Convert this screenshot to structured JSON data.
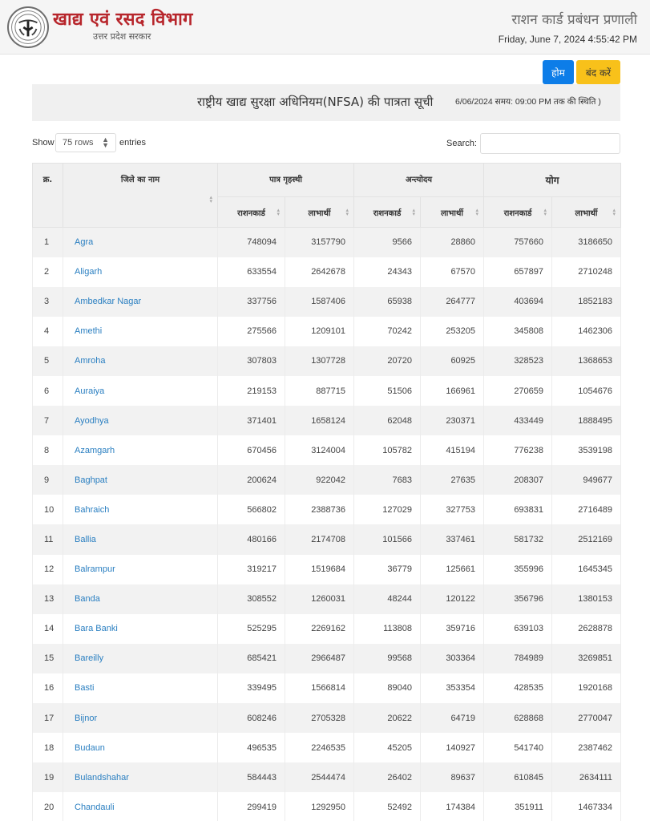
{
  "header": {
    "brand_title": "खाद्य एवं रसद विभाग",
    "brand_subtitle": "उत्तर प्रदेश सरकार",
    "system_title": "राशन कार्ड प्रबंधन प्रणाली",
    "datetime": "Friday, June 7, 2024 4:55:42 PM",
    "logo_icon": "up-govt-emblem-icon"
  },
  "actions": {
    "home_label": "होम",
    "close_label": "बंद करें",
    "home_color": "#0d7de8",
    "close_color": "#f8c11a"
  },
  "page": {
    "title": "राष्ट्रीय खाद्य सुरक्षा अधिनियम(NFSA) की पात्रता सूची",
    "status_note": "6/06/2024 समय: 09:00 PM तक की स्थिति )"
  },
  "controls": {
    "show_label": "Show",
    "rows_selected": "75 rows",
    "entries_label": "entries",
    "search_label": "Search:",
    "search_value": ""
  },
  "table": {
    "headers": {
      "serial": "क्र.",
      "district": "जिले का नाम",
      "groups": [
        "पात्र गृहस्थी",
        "अन्त्योदय",
        "योग"
      ],
      "sub": [
        "राशनकार्ड",
        "लाभार्थी",
        "राशनकार्ड",
        "लाभार्थी",
        "राशनकार्ड",
        "लाभार्थी"
      ]
    },
    "rows": [
      {
        "sn": "1",
        "district": "Agra",
        "v": [
          "748094",
          "3157790",
          "9566",
          "28860",
          "757660",
          "3186650"
        ]
      },
      {
        "sn": "2",
        "district": "Aligarh",
        "v": [
          "633554",
          "2642678",
          "24343",
          "67570",
          "657897",
          "2710248"
        ]
      },
      {
        "sn": "3",
        "district": "Ambedkar Nagar",
        "v": [
          "337756",
          "1587406",
          "65938",
          "264777",
          "403694",
          "1852183"
        ]
      },
      {
        "sn": "4",
        "district": "Amethi",
        "v": [
          "275566",
          "1209101",
          "70242",
          "253205",
          "345808",
          "1462306"
        ]
      },
      {
        "sn": "5",
        "district": "Amroha",
        "v": [
          "307803",
          "1307728",
          "20720",
          "60925",
          "328523",
          "1368653"
        ]
      },
      {
        "sn": "6",
        "district": "Auraiya",
        "v": [
          "219153",
          "887715",
          "51506",
          "166961",
          "270659",
          "1054676"
        ]
      },
      {
        "sn": "7",
        "district": "Ayodhya",
        "v": [
          "371401",
          "1658124",
          "62048",
          "230371",
          "433449",
          "1888495"
        ]
      },
      {
        "sn": "8",
        "district": "Azamgarh",
        "v": [
          "670456",
          "3124004",
          "105782",
          "415194",
          "776238",
          "3539198"
        ]
      },
      {
        "sn": "9",
        "district": "Baghpat",
        "v": [
          "200624",
          "922042",
          "7683",
          "27635",
          "208307",
          "949677"
        ]
      },
      {
        "sn": "10",
        "district": "Bahraich",
        "v": [
          "566802",
          "2388736",
          "127029",
          "327753",
          "693831",
          "2716489"
        ]
      },
      {
        "sn": "11",
        "district": "Ballia",
        "v": [
          "480166",
          "2174708",
          "101566",
          "337461",
          "581732",
          "2512169"
        ]
      },
      {
        "sn": "12",
        "district": "Balrampur",
        "v": [
          "319217",
          "1519684",
          "36779",
          "125661",
          "355996",
          "1645345"
        ]
      },
      {
        "sn": "13",
        "district": "Banda",
        "v": [
          "308552",
          "1260031",
          "48244",
          "120122",
          "356796",
          "1380153"
        ]
      },
      {
        "sn": "14",
        "district": "Bara Banki",
        "v": [
          "525295",
          "2269162",
          "113808",
          "359716",
          "639103",
          "2628878"
        ]
      },
      {
        "sn": "15",
        "district": "Bareilly",
        "v": [
          "685421",
          "2966487",
          "99568",
          "303364",
          "784989",
          "3269851"
        ]
      },
      {
        "sn": "16",
        "district": "Basti",
        "v": [
          "339495",
          "1566814",
          "89040",
          "353354",
          "428535",
          "1920168"
        ]
      },
      {
        "sn": "17",
        "district": "Bijnor",
        "v": [
          "608246",
          "2705328",
          "20622",
          "64719",
          "628868",
          "2770047"
        ]
      },
      {
        "sn": "18",
        "district": "Budaun",
        "v": [
          "496535",
          "2246535",
          "45205",
          "140927",
          "541740",
          "2387462"
        ]
      },
      {
        "sn": "19",
        "district": "Bulandshahar",
        "v": [
          "584443",
          "2544474",
          "26402",
          "89637",
          "610845",
          "2634111"
        ]
      },
      {
        "sn": "20",
        "district": "Chandauli",
        "v": [
          "299419",
          "1292950",
          "52492",
          "174384",
          "351911",
          "1467334"
        ]
      }
    ]
  }
}
